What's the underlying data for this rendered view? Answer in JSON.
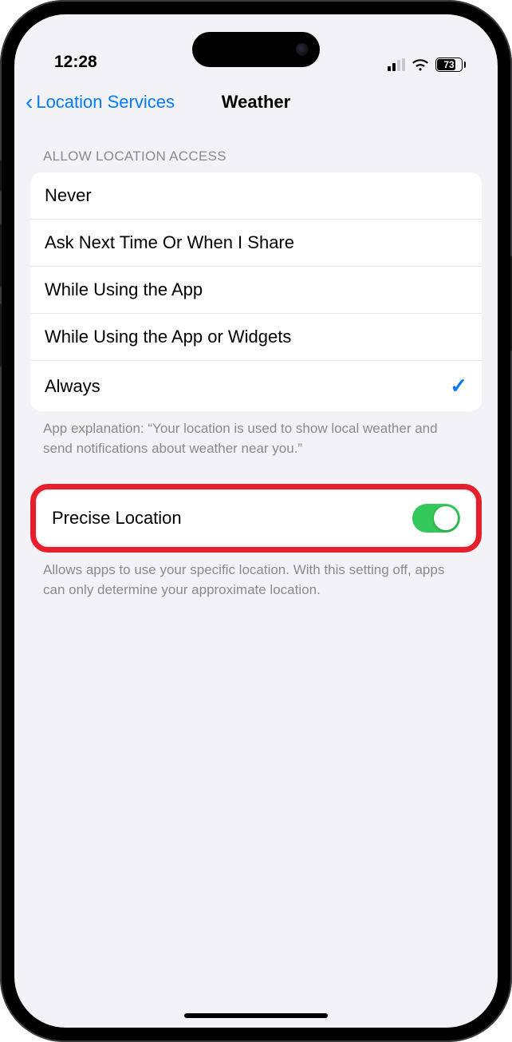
{
  "status": {
    "time": "12:28",
    "battery_pct": "73"
  },
  "nav": {
    "back_label": "Location Services",
    "title": "Weather"
  },
  "section1": {
    "header": "Allow Location Access",
    "options": {
      "never": "Never",
      "ask": "Ask Next Time Or When I Share",
      "while_app": "While Using the App",
      "while_widgets": "While Using the App or Widgets",
      "always": "Always"
    },
    "selected": "always",
    "footer": "App explanation: “Your location is used to show local weather and send notifications about weather near you.”"
  },
  "section2": {
    "row_label": "Precise Location",
    "toggle_on": true,
    "footer": "Allows apps to use your specific location. With this setting off, apps can only determine your approximate location."
  }
}
